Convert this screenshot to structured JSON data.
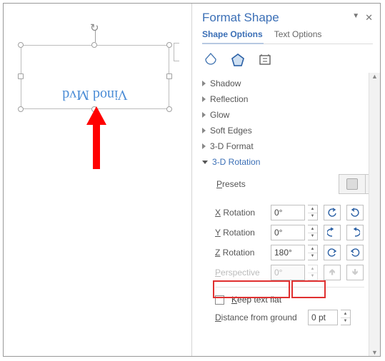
{
  "canvas": {
    "shape_text": "Vinod Mvd"
  },
  "pane": {
    "title": "Format Shape",
    "tabs": {
      "shape": "Shape Options",
      "text": "Text Options"
    },
    "sections": {
      "shadow": "Shadow",
      "reflection": "Reflection",
      "glow": "Glow",
      "soft_edges": "Soft Edges",
      "fmt3d": "3-D Format",
      "rot3d": "3-D Rotation"
    },
    "rot": {
      "presets": "Presets",
      "x_label": "X Rotation",
      "x_val": "0°",
      "y_label": "Y Rotation",
      "y_val": "0°",
      "z_label": "Z Rotation",
      "z_val": "180°",
      "p_label": "Perspective",
      "p_val": "0°",
      "keep_flat": "Keep text flat",
      "dist_label": "Distance from ground",
      "dist_val": "0 pt"
    }
  }
}
